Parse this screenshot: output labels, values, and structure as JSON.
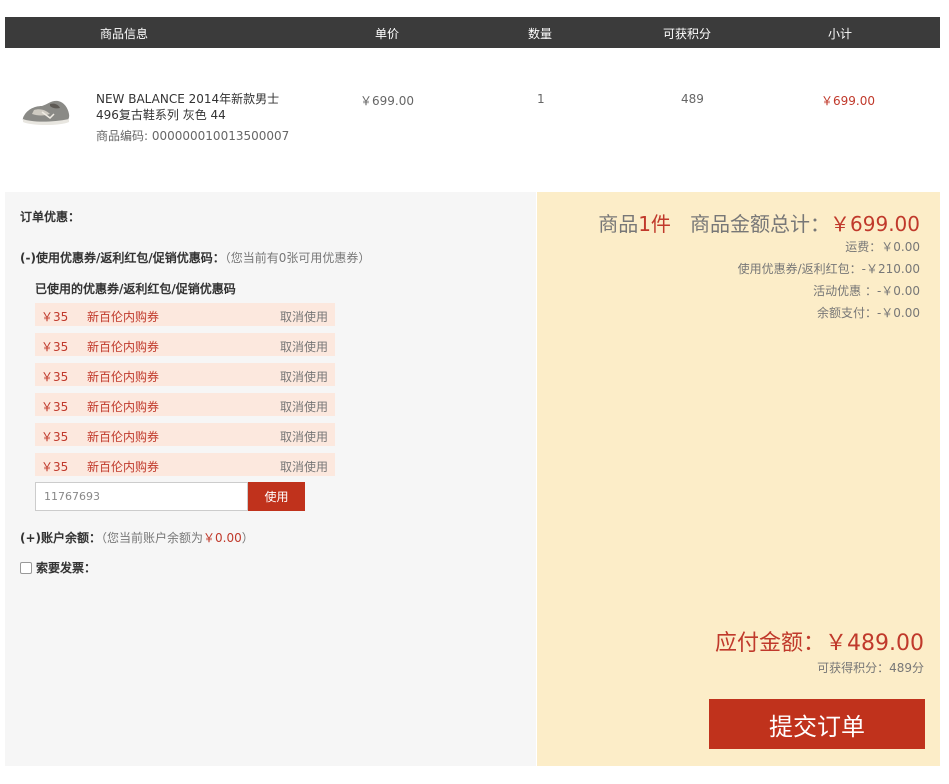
{
  "table_header": {
    "info": "商品信息",
    "price": "单价",
    "qty": "数量",
    "points": "可获积分",
    "subtotal": "小计"
  },
  "product": {
    "name": "NEW BALANCE 2014年新款男士496复古鞋系列 灰色 44",
    "code_label": "商品编码: 000000010013500007",
    "price": "￥699.00",
    "qty": "1",
    "points": "489",
    "subtotal": "￥699.00",
    "image_icon": "shoe-icon"
  },
  "left": {
    "order_discount": "订单优惠：",
    "coupon_title": "(-)使用优惠券/返利红包/促销优惠码：",
    "coupon_hint": "（您当前有0张可用优惠券）",
    "used_title": "已使用的优惠券/返利红包/促销优惠码",
    "coupons": [
      {
        "amount": "￥35",
        "name": "新百伦内购券",
        "cancel": "取消使用"
      },
      {
        "amount": "￥35",
        "name": "新百伦内购券",
        "cancel": "取消使用"
      },
      {
        "amount": "￥35",
        "name": "新百伦内购券",
        "cancel": "取消使用"
      },
      {
        "amount": "￥35",
        "name": "新百伦内购券",
        "cancel": "取消使用"
      },
      {
        "amount": "￥35",
        "name": "新百伦内购券",
        "cancel": "取消使用"
      },
      {
        "amount": "￥35",
        "name": "新百伦内购券",
        "cancel": "取消使用"
      }
    ],
    "code_input_value": "11767693",
    "use_button": "使用",
    "balance_title": "(+)账户余额：",
    "balance_hint_prefix": "（您当前账户余额为",
    "balance_amount": "￥0.00",
    "balance_hint_suffix": "）",
    "invoice_label": "索要发票："
  },
  "right": {
    "count_prefix": "商品",
    "count_value": "1件",
    "total_label": "商品金额总计：",
    "total_value": "￥699.00",
    "shipping": "运费：￥0.00",
    "coupon_used": "使用优惠券/返利红包：-￥210.00",
    "activity": "活动优惠 ：-￥0.00",
    "balance_pay": "余额支付：-￥0.00",
    "pay_label": "应付金额：",
    "pay_value": "￥489.00",
    "earn_points": "可获得积分：489分",
    "submit": "提交订单"
  },
  "colors": {
    "accent_red": "#c0321c",
    "header_bg": "#3b3b3b",
    "summary_bg": "#fcedc8",
    "coupon_bg": "#fce8de"
  }
}
